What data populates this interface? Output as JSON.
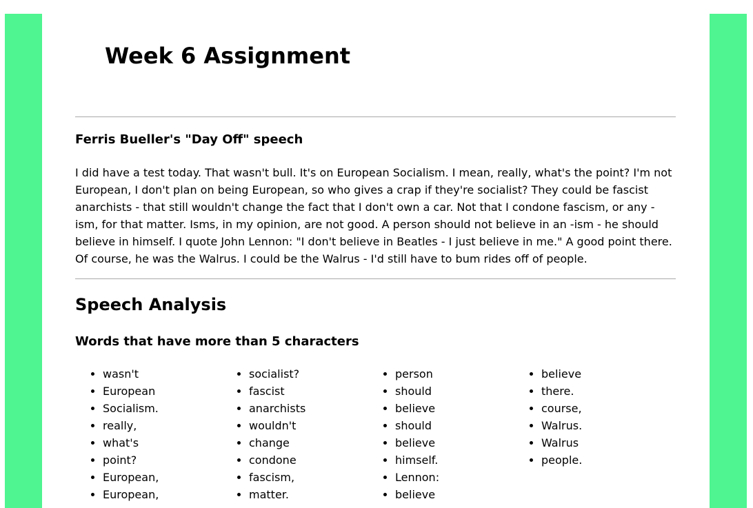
{
  "colors": {
    "side_panel": "#4ef591",
    "rule": "#a8a8a8"
  },
  "page": {
    "title": "Week 6 Assignment"
  },
  "speech": {
    "title": "Ferris Bueller's \"Day Off\" speech",
    "text": "I did have a test today. That wasn't bull. It's on European Socialism. I mean, really, what's the point? I'm not European, I don't plan on being European, so who gives a crap if they're socialist? They could be fascist anarchists - that still wouldn't change the fact that I don't own a car. Not that I condone fascism, or any -ism, for that matter. Isms, in my opinion, are not good. A person should not believe in an -ism - he should believe in himself. I quote John Lennon: \"I don't believe in Beatles - I just believe in me.\" A good point there. Of course, he was the Walrus. I could be the Walrus - I'd still have to bum rides off of people."
  },
  "analysis": {
    "title": "Speech Analysis",
    "words_title": "Words that have more than 5 characters",
    "columns": [
      [
        "wasn't",
        "European",
        "Socialism.",
        "really,",
        "what's",
        "point?",
        "European,",
        "European,"
      ],
      [
        "socialist?",
        "fascist",
        "anarchists",
        "wouldn't",
        "change",
        "condone",
        "fascism,",
        "matter."
      ],
      [
        "person",
        "should",
        "believe",
        "should",
        "believe",
        "himself.",
        "Lennon:",
        "believe"
      ],
      [
        "believe",
        "there.",
        "course,",
        "Walrus.",
        "Walrus",
        "people."
      ]
    ]
  }
}
